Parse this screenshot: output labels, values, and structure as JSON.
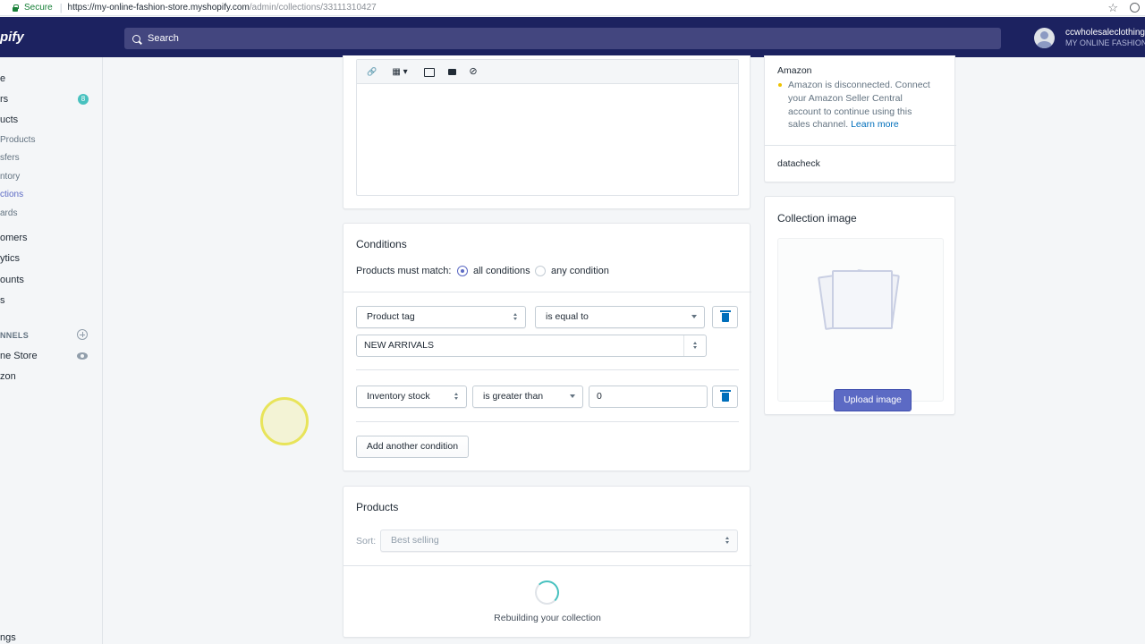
{
  "browser": {
    "secure_label": "Secure",
    "url_host": "https://my-online-fashion-store.myshopify.com",
    "url_path": "/admin/collections/33111310427"
  },
  "topbar": {
    "logo": "pify",
    "search_placeholder": "Search",
    "user_name": "ccwholesaleclothing",
    "store_name": "MY ONLINE FASHION"
  },
  "sidebar": {
    "items": [
      {
        "label": "e"
      },
      {
        "label": "rs"
      },
      {
        "label": "ucts"
      },
      {
        "label": "Products"
      },
      {
        "label": "sfers"
      },
      {
        "label": "ntory"
      },
      {
        "label": "ctions"
      },
      {
        "label": "ards"
      },
      {
        "label": "omers"
      },
      {
        "label": "ytics"
      },
      {
        "label": "ounts"
      },
      {
        "label": "s"
      },
      {
        "label": "NNELS"
      },
      {
        "label": "ne Store"
      },
      {
        "label": "zon"
      },
      {
        "label": "ngs"
      }
    ],
    "orders_badge": "8"
  },
  "conditions": {
    "title": "Conditions",
    "match_label": "Products must match:",
    "option_all": "all conditions",
    "option_any": "any condition",
    "rule1": {
      "field": "Product tag",
      "operator": "is equal to",
      "value": "NEW ARRIVALS"
    },
    "rule2": {
      "field": "Inventory stock",
      "operator": "is greater than",
      "value": "0"
    },
    "add_button": "Add another condition"
  },
  "products": {
    "title": "Products",
    "sort_label": "Sort:",
    "sort_value": "Best selling",
    "status": "Rebuilding your collection"
  },
  "channels": {
    "amazon_title": "Amazon",
    "amazon_message": "Amazon is disconnected. Connect your Amazon Seller Central account to continue using this sales channel.",
    "learn_more": "Learn more",
    "datacheck": "datacheck"
  },
  "collection_image": {
    "title": "Collection image",
    "upload_button": "Upload image"
  }
}
